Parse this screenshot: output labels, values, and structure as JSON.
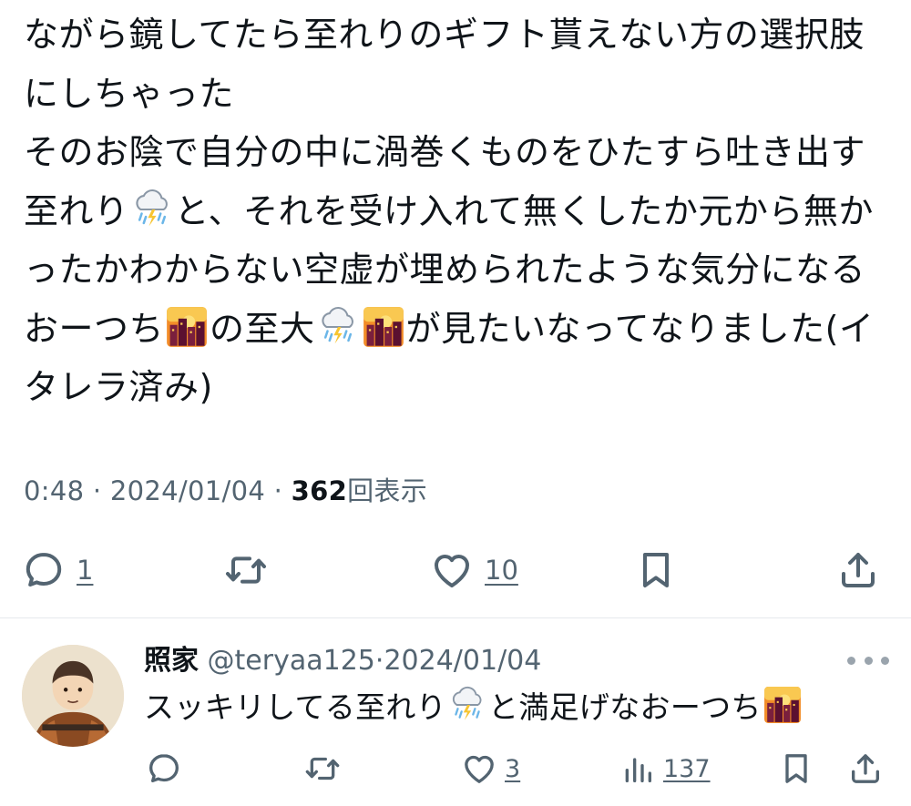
{
  "tweet": {
    "text_segments": [
      "ながら鏡してたら至れりのギフト貰えない方の選択肢にしちゃった\nそのお陰で自分の中に渦巻くものをひたすら吐き出す至れり",
      "と、それを受け入れて無くしたか元から無かったかわからない空虚が埋められたような気分になるおーつち",
      "の至大",
      "",
      "が見たいなってなりました(イタレラ済み)"
    ],
    "emoji_names": [
      "thunder-cloud-rain",
      "city-sunset",
      "thunder-cloud-rain",
      "city-sunset"
    ],
    "time": "0:48",
    "separator": "·",
    "date": "2024/01/04",
    "views_count": "362",
    "views_label": "回表示"
  },
  "actions": {
    "reply_count": "1",
    "like_count": "10"
  },
  "reply": {
    "name": "照家",
    "handle": "@teryaa125",
    "separator": "·",
    "date": "2024/01/04",
    "text_segments": [
      "スッキリしてる至れり",
      "と満足げなおーつち"
    ],
    "emoji_names": [
      "thunder-cloud-rain",
      "city-sunset"
    ],
    "reply_count": "",
    "like_count": "3",
    "views_count": "137"
  },
  "colors": {
    "text": "#0f1419",
    "secondary": "#536471",
    "divider": "#e6e9ec"
  }
}
